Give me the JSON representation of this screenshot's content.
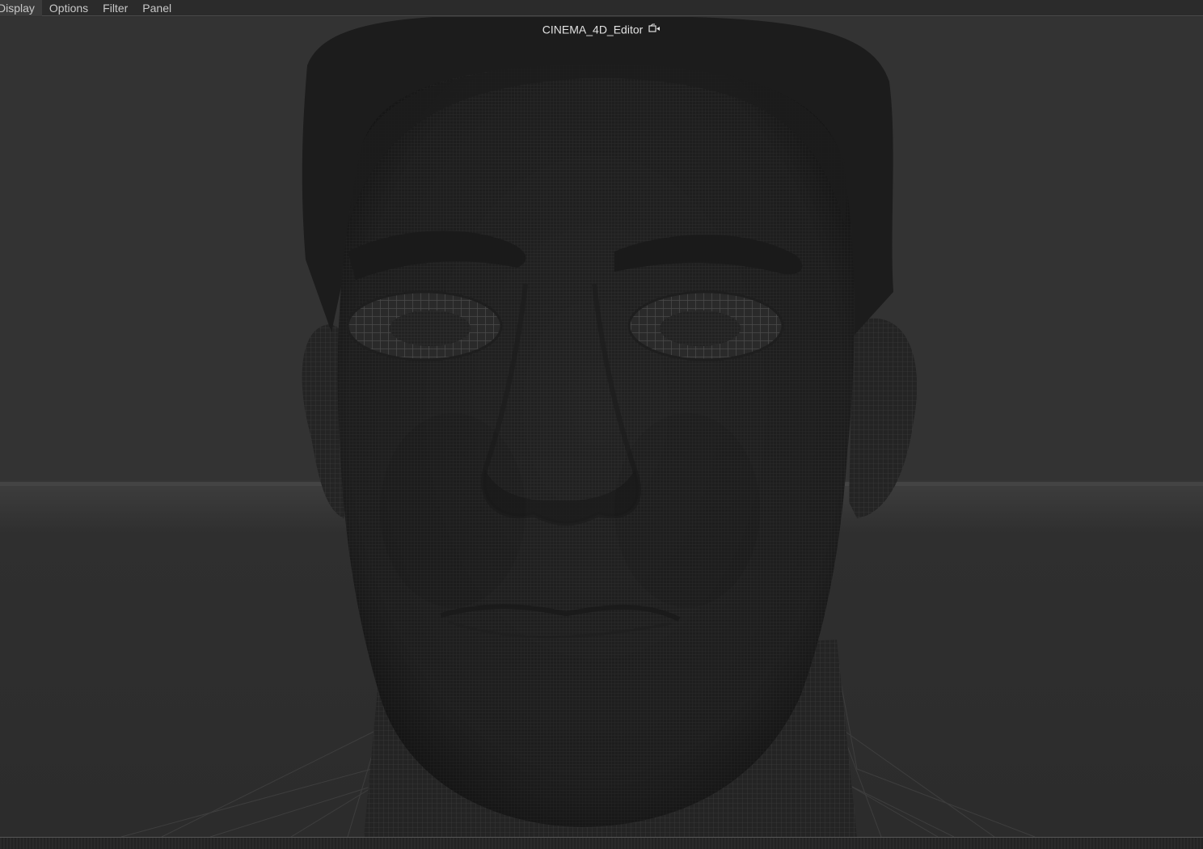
{
  "menu": {
    "items": [
      {
        "name": "menu-display",
        "label": "Display"
      },
      {
        "name": "menu-options",
        "label": "Options"
      },
      {
        "name": "menu-filter",
        "label": "Filter"
      },
      {
        "name": "menu-panel",
        "label": "Panel"
      }
    ]
  },
  "viewport": {
    "camera_label": "CINEMA_4D_Editor",
    "camera_icon": "camera-icon",
    "content": "wireframe-head-mesh"
  },
  "colors": {
    "background": "#333333",
    "menu_text": "#c8c8c8",
    "label_text": "#e2e2e2",
    "mesh_fill": "#242424",
    "mesh_wire": "#3c3c3c",
    "hair": "#1a1a1a"
  }
}
